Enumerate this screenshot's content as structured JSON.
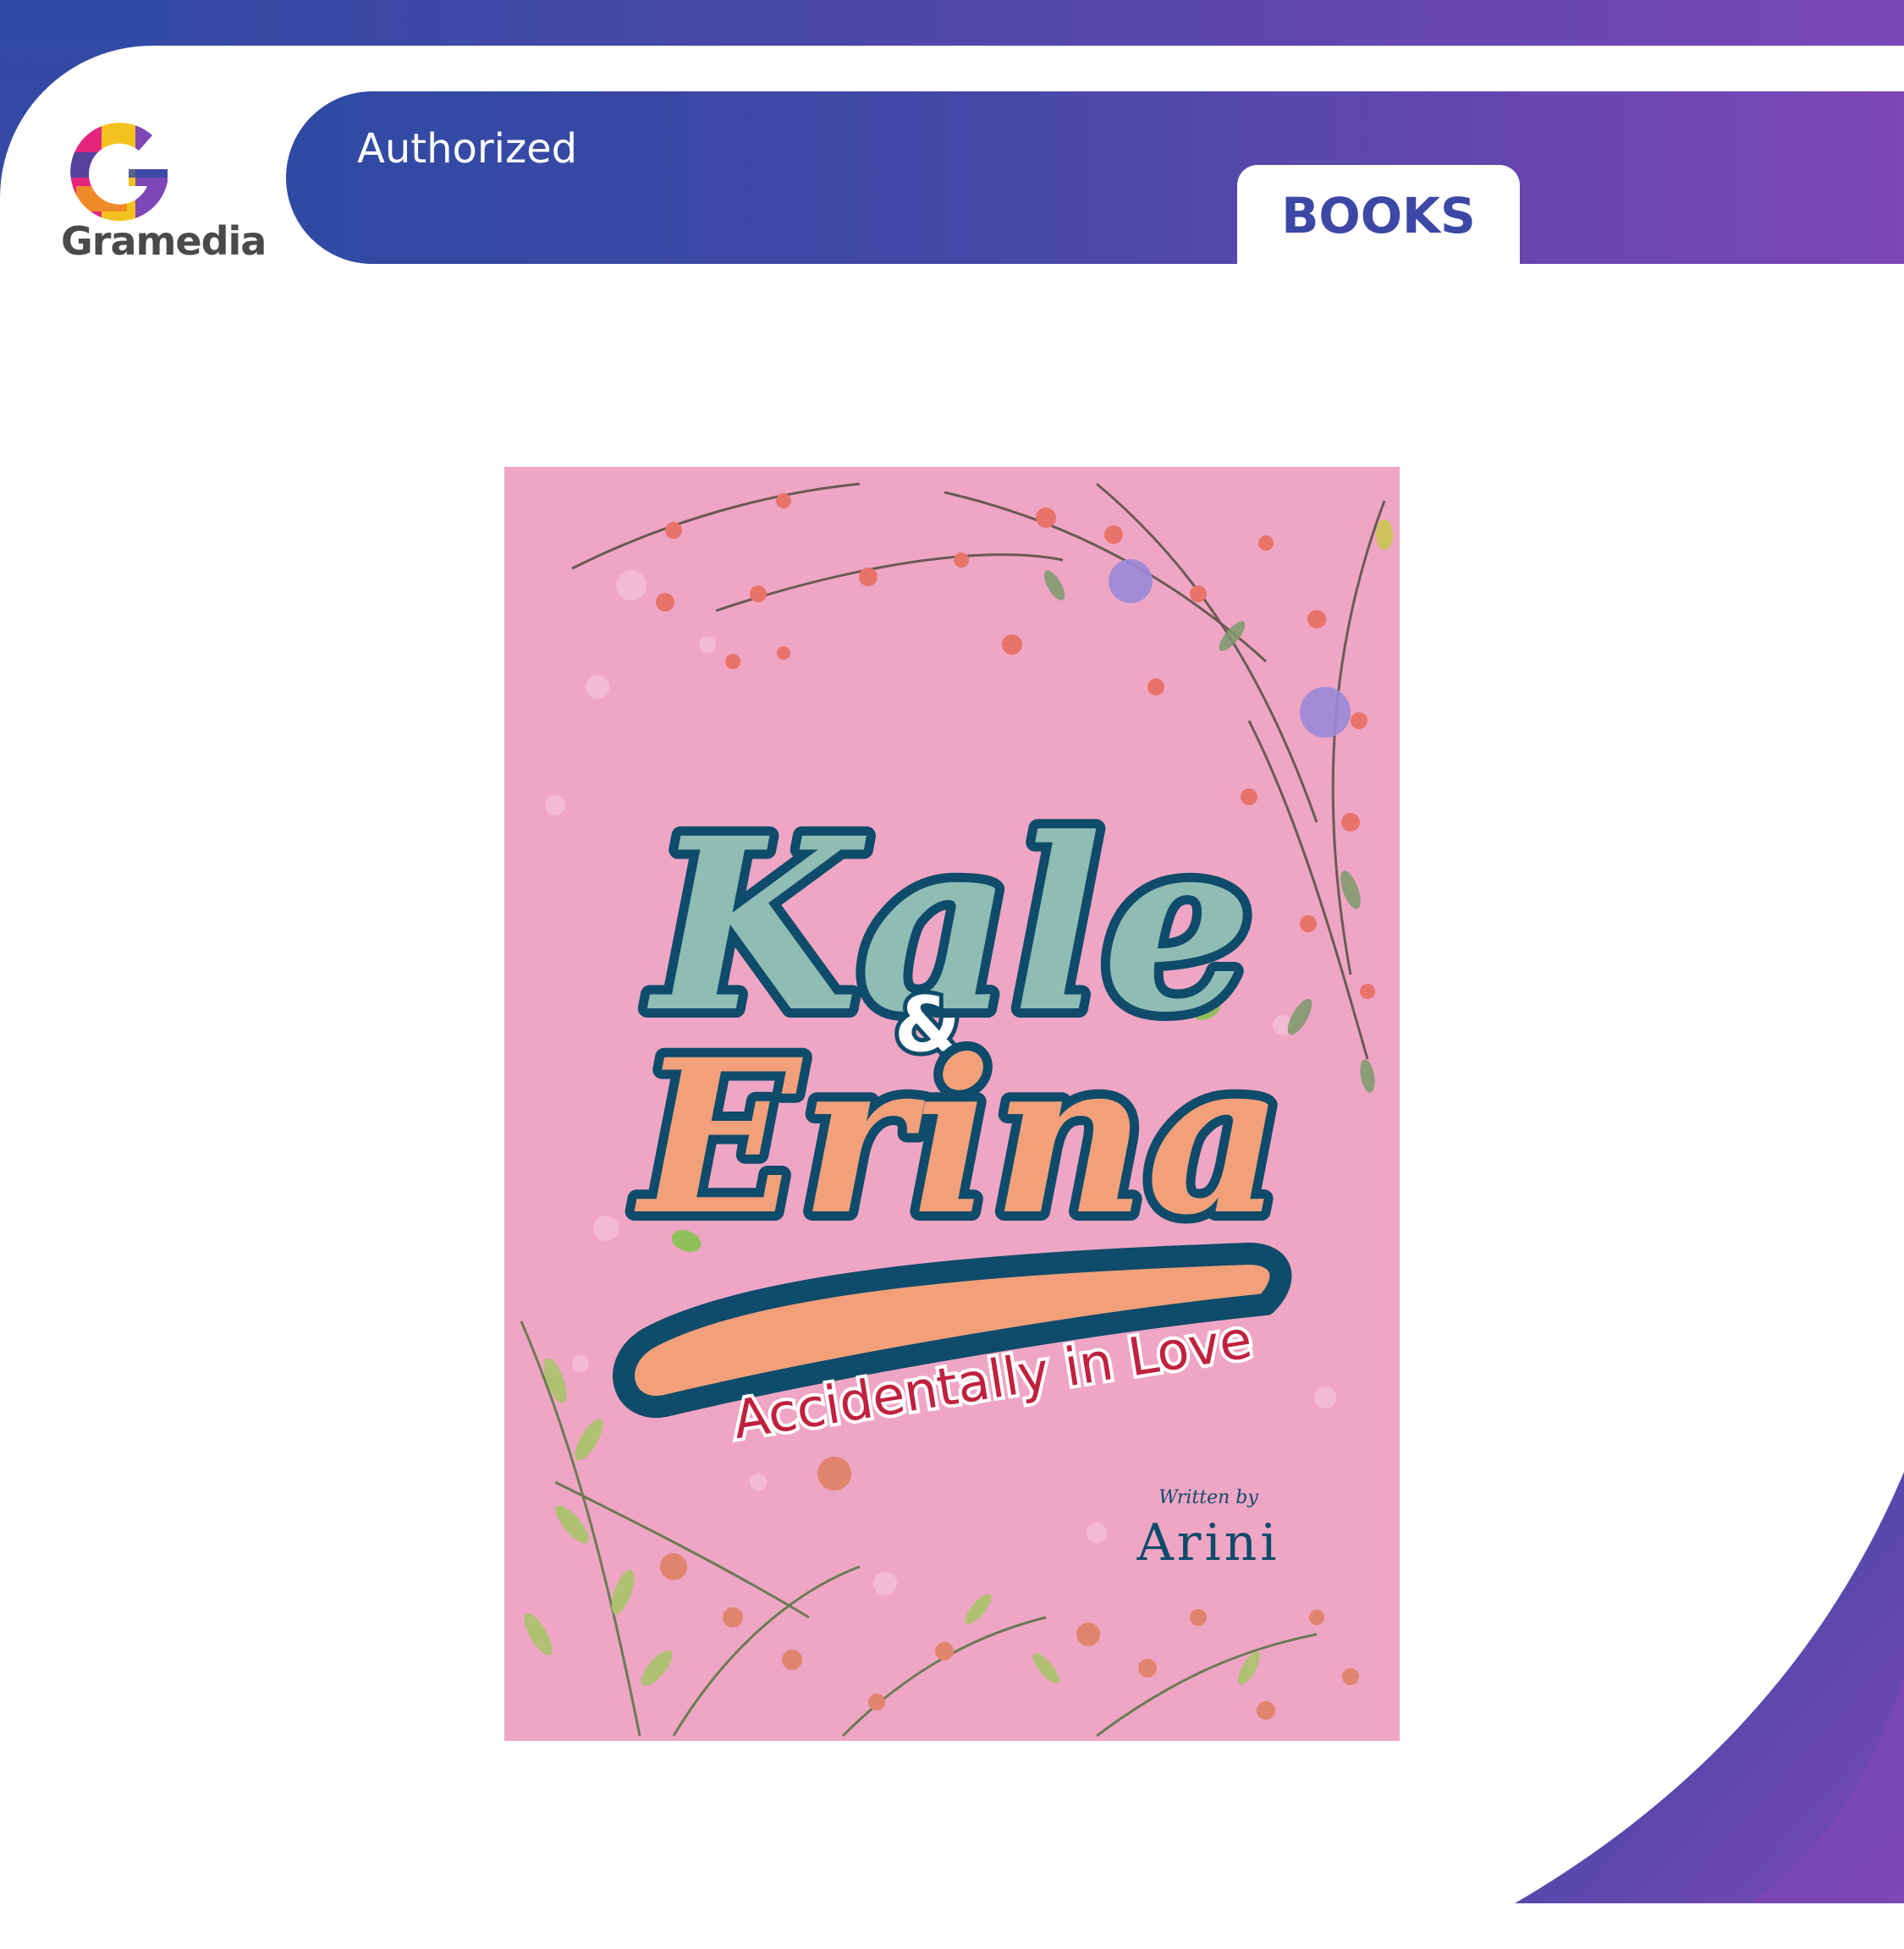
{
  "brand": {
    "name": "Gramedia"
  },
  "header": {
    "authorized_label": "Authorized",
    "category_tab": "BOOKS"
  },
  "book": {
    "title_line1": "Kale",
    "ampersand": "&",
    "title_line2": "Erina",
    "subtitle": "Accidentally in Love",
    "written_by_label": "Written by",
    "author": "Arini"
  },
  "colors": {
    "brand_blue": "#2f4aa3",
    "brand_purple": "#7d47b5",
    "cover_pink": "#efa6c4",
    "title_teal": "#8fbcb3",
    "title_orange": "#f2a07a",
    "outline_navy": "#0f4b6a",
    "subtitle_red": "#c0213f"
  }
}
